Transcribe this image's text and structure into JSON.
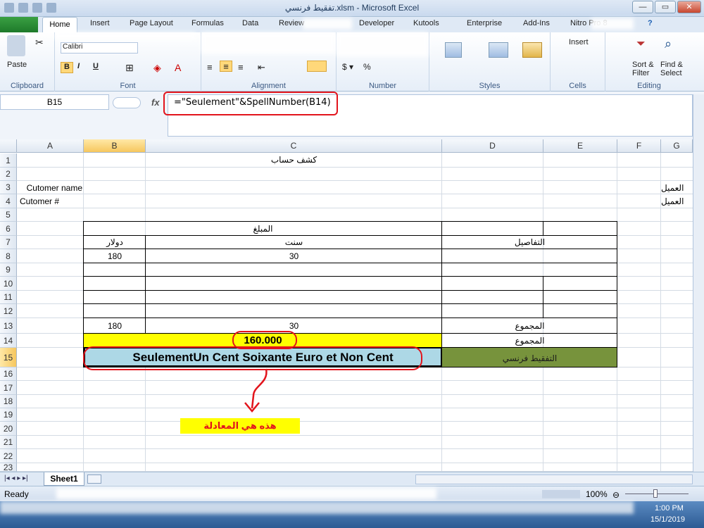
{
  "window": {
    "title": "تفقيط فرنسي.xlsm - Microsoft Excel",
    "min": "—",
    "restore": "▭",
    "close": "✕",
    "help": "?"
  },
  "tabs": [
    "Home",
    "Insert",
    "Page Layout",
    "Formulas",
    "Data",
    "Review",
    "Developer",
    "Kutools",
    "Enterprise",
    "Add-Ins",
    "Nitro Pro 8"
  ],
  "ribbon": {
    "groups": {
      "clipboard": "Clipboard",
      "font": "Font",
      "alignment": "Alignment",
      "number": "Number",
      "styles": "Styles",
      "cells": "Cells",
      "editing": "Editing"
    },
    "paste": "Paste",
    "font_name": "Calibri",
    "bold": "B",
    "italic": "I",
    "underline": "U",
    "insert": "Insert",
    "sort_filter": "Sort & Filter",
    "find_select": "Find & Select"
  },
  "namebox": "B15",
  "fx": "fx",
  "formula": "=\"Seulement\"&SpellNumber(B14)",
  "columns": [
    "A",
    "B",
    "C",
    "D",
    "E",
    "F",
    "G"
  ],
  "rows": [
    "1",
    "2",
    "3",
    "4",
    "5",
    "6",
    "7",
    "8",
    "9",
    "10",
    "11",
    "12",
    "13",
    "14",
    "15",
    "16",
    "17",
    "18",
    "19",
    "20",
    "21",
    "22",
    "23"
  ],
  "cells": {
    "c1": "كشف حساب",
    "a3": "Cutomer name",
    "g3": "العميل",
    "a4": "Cutomer #",
    "g4": "العميل",
    "b6c6": "المبلغ",
    "b7": "دولار",
    "c7": "سنت",
    "d7": "التفاصيل",
    "b8": "180",
    "c8": "30",
    "b13": "180",
    "c13": "30",
    "d13": "المجموع",
    "b14": "160.000",
    "d14": "المجموع",
    "b15": "SeulementUn Cent Soixante Euro et Non Cent",
    "d15": "التفقيط فرنسي"
  },
  "annotation": "هذه هي المعادلة",
  "sheet_tab": "Sheet1",
  "status": {
    "ready": "Ready",
    "zoom": "100%"
  },
  "clock": {
    "time": "1:00 PM",
    "date": "15/1/2019"
  },
  "colors": {
    "yellow": "#ffff00",
    "lightblue": "#add8e6",
    "green": "#77933c",
    "red": "#e2141c"
  }
}
